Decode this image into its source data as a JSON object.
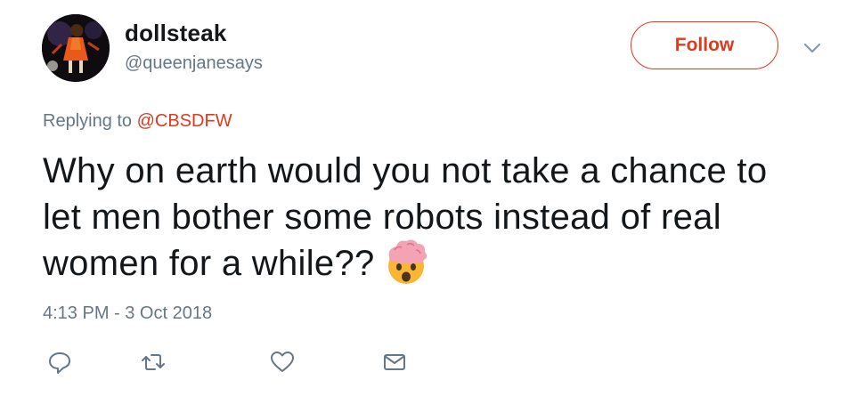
{
  "user": {
    "display_name": "dollsteak",
    "handle": "@queenjanesays",
    "avatar_icon": "avatar-illustration"
  },
  "header": {
    "follow_label": "Follow",
    "menu_icon": "chevron-down-icon"
  },
  "reply": {
    "prefix": "Replying to",
    "to_handle": "@CBSDFW"
  },
  "tweet": {
    "lines": [
      "Why on earth would you not take a chance to",
      "let men bother some robots instead of real",
      "women for a while??"
    ],
    "emoji": "exploding-head-emoji"
  },
  "meta": {
    "timestamp": "4:13 PM - 3 Oct 2018"
  },
  "actions": {
    "icons": [
      "reply-icon",
      "retweet-icon",
      "like-icon",
      "direct-message-icon"
    ]
  },
  "colors": {
    "accent": "#e0391c",
    "text": "#14171a",
    "muted": "#657786"
  }
}
